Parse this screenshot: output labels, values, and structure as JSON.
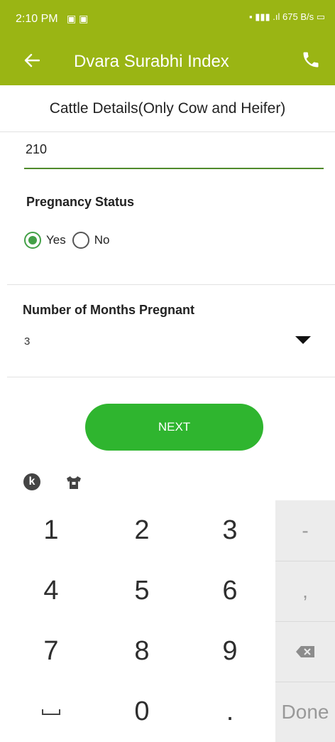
{
  "status_bar": {
    "time": "2:10 PM",
    "notifications": "▣ ▣",
    "right": "▪ ▮▮▮ .ıl 675 B/s ▭"
  },
  "app_bar": {
    "title": "Dvara Surabhi Index",
    "back_icon": "arrow-left",
    "call_icon": "phone"
  },
  "sub_header": {
    "title": "Cattle Details(Only Cow and Heifer)"
  },
  "form": {
    "number_input_value": "210",
    "pregnancy_status": {
      "label": "Pregnancy Status",
      "options": [
        "Yes",
        "No"
      ],
      "selected": "Yes"
    },
    "months_pregnant": {
      "label": "Number of Months Pregnant",
      "value": "3"
    },
    "next_label": "NEXT"
  },
  "keyboard": {
    "rows": [
      [
        "1",
        "2",
        "3"
      ],
      [
        "4",
        "5",
        "6"
      ],
      [
        "7",
        "8",
        "9"
      ],
      [
        "",
        "0",
        "."
      ]
    ],
    "side_keys": [
      "-",
      ",",
      "",
      "Done"
    ],
    "toolbar_icons": [
      "k-logo",
      "shirt"
    ]
  },
  "colors": {
    "app_bar": "#9ab514",
    "primary_green": "#2fb52f",
    "radio_green": "#43a047"
  }
}
